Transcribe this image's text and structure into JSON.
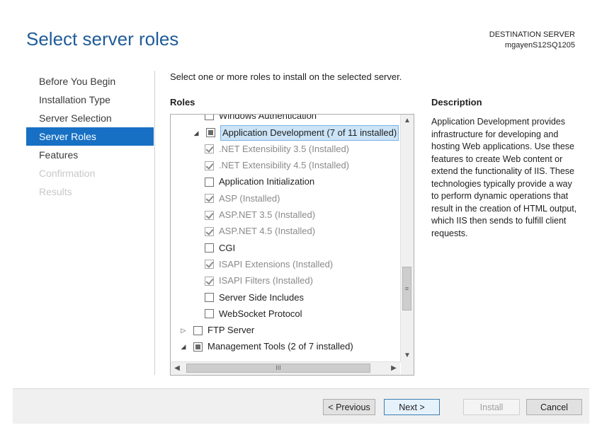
{
  "header": {
    "title": "Select server roles",
    "destination_label": "DESTINATION SERVER",
    "destination_server": "mgayenS12SQ1205"
  },
  "nav": {
    "items": [
      {
        "label": "Before You Begin",
        "state": "normal"
      },
      {
        "label": "Installation Type",
        "state": "normal"
      },
      {
        "label": "Server Selection",
        "state": "normal"
      },
      {
        "label": "Server Roles",
        "state": "active"
      },
      {
        "label": "Features",
        "state": "normal"
      },
      {
        "label": "Confirmation",
        "state": "disabled"
      },
      {
        "label": "Results",
        "state": "disabled"
      }
    ]
  },
  "main": {
    "instruction": "Select one or more roles to install on the selected server.",
    "roles_label": "Roles",
    "description_label": "Description",
    "description_text": "Application Development provides infrastructure for developing and hosting Web applications. Use these features to create Web content or extend the functionality of IIS. These technologies typically provide a way to perform dynamic operations that result in the creation of HTML output, which IIS then sends to fulfill client requests."
  },
  "tree": {
    "rows": [
      {
        "label": "Windows Authentication",
        "level": 3,
        "expander": "",
        "check": "unchecked",
        "gray": false,
        "selected": false
      },
      {
        "label": "Application Development (7 of 11 installed)",
        "level": 2,
        "expander": "expanded",
        "check": "partial",
        "gray": false,
        "selected": true
      },
      {
        "label": ".NET Extensibility 3.5 (Installed)",
        "level": 3,
        "expander": "",
        "check": "checked",
        "gray": true,
        "selected": false
      },
      {
        "label": ".NET Extensibility 4.5 (Installed)",
        "level": 3,
        "expander": "",
        "check": "checked",
        "gray": true,
        "selected": false
      },
      {
        "label": "Application Initialization",
        "level": 3,
        "expander": "",
        "check": "unchecked",
        "gray": false,
        "selected": false
      },
      {
        "label": "ASP (Installed)",
        "level": 3,
        "expander": "",
        "check": "checked",
        "gray": true,
        "selected": false
      },
      {
        "label": "ASP.NET 3.5 (Installed)",
        "level": 3,
        "expander": "",
        "check": "checked",
        "gray": true,
        "selected": false
      },
      {
        "label": "ASP.NET 4.5 (Installed)",
        "level": 3,
        "expander": "",
        "check": "checked",
        "gray": true,
        "selected": false
      },
      {
        "label": "CGI",
        "level": 3,
        "expander": "",
        "check": "unchecked",
        "gray": false,
        "selected": false
      },
      {
        "label": "ISAPI Extensions (Installed)",
        "level": 3,
        "expander": "",
        "check": "checked",
        "gray": true,
        "selected": false
      },
      {
        "label": "ISAPI Filters (Installed)",
        "level": 3,
        "expander": "",
        "check": "checked",
        "gray": true,
        "selected": false
      },
      {
        "label": "Server Side Includes",
        "level": 3,
        "expander": "",
        "check": "unchecked",
        "gray": false,
        "selected": false
      },
      {
        "label": "WebSocket Protocol",
        "level": 3,
        "expander": "",
        "check": "unchecked",
        "gray": false,
        "selected": false
      },
      {
        "label": "FTP Server",
        "level": 1,
        "expander": "collapsed",
        "check": "unchecked",
        "gray": false,
        "selected": false
      },
      {
        "label": "Management Tools (2 of 7 installed)",
        "level": 1,
        "expander": "expanded",
        "check": "partial",
        "gray": false,
        "selected": false
      }
    ],
    "icons": {
      "scroll_up": "▲",
      "scroll_down": "▼",
      "scroll_left": "◀",
      "scroll_right": "▶",
      "thumb_grip_v": "≡",
      "thumb_grip_h": "III"
    }
  },
  "footer": {
    "previous_label": "< Previous",
    "next_label": "Next >",
    "install_label": "Install",
    "cancel_label": "Cancel"
  }
}
